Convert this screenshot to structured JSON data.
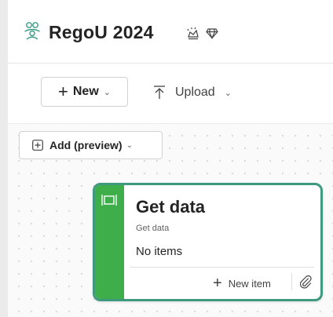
{
  "header": {
    "title": "RegoU 2024",
    "workspace_icon": "people-group-icon",
    "title_icons": [
      "sparkle-crown-icon",
      "diamond-icon"
    ]
  },
  "toolbar": {
    "new_label": "New",
    "upload_label": "Upload"
  },
  "canvas": {
    "add_label": "Add (preview)"
  },
  "card": {
    "title": "Get data",
    "subtitle": "Get data",
    "empty_text": "No items",
    "new_item_label": "New item",
    "accent_color": "#3dae49",
    "border_color": "#3d9a7f"
  }
}
